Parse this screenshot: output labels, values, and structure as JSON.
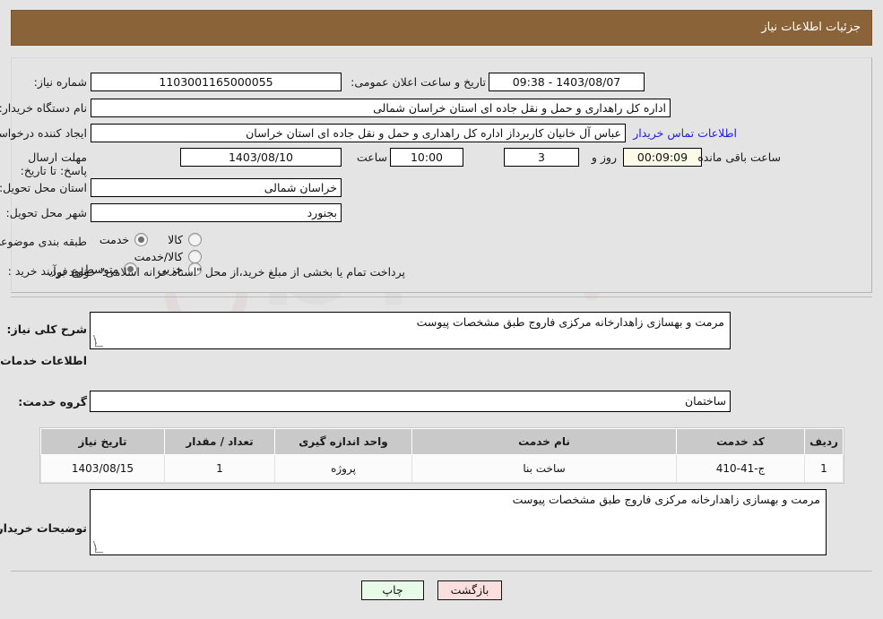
{
  "header": {
    "title": "جزئیات اطلاعات نیاز"
  },
  "form": {
    "need_number_label": "شماره نیاز:",
    "need_number_value": "1103001165000055",
    "announce_label": "تاریخ و ساعت اعلان عمومی:",
    "announce_value": "1403/08/07 - 09:38",
    "buyer_org_label": "نام دستگاه خریدار:",
    "buyer_org_value": "اداره کل راهداری و حمل و نقل جاده ای استان خراسان شمالی",
    "creator_label": "ایجاد کننده درخواست:",
    "creator_value": "عباس آل خانیان کاربرداز اداره کل راهداری و حمل و نقل جاده ای استان خراسان",
    "contact_link": "اطلاعات تماس خریدار",
    "deadline_label": "مهلت ارسال پاسخ: تا تاریخ:",
    "deadline_date": "1403/08/10",
    "hour_label": "ساعت",
    "deadline_time": "10:00",
    "days_value": "3",
    "days_label": "روز و",
    "countdown_value": "00:09:09",
    "remaining_label": "ساعت باقی مانده",
    "province_label": "استان محل تحویل:",
    "province_value": "خراسان شمالی",
    "city_label": "شهر محل تحویل:",
    "city_value": "بجنورد",
    "category_label": "طبقه بندی موضوعی:",
    "category_options": [
      {
        "label": "کالا",
        "selected": false
      },
      {
        "label": "خدمت",
        "selected": true
      },
      {
        "label": "کالا/خدمت",
        "selected": false
      }
    ],
    "process_label": "نوع فرآیند خرید :",
    "process_options": [
      {
        "label": "جزیی",
        "selected": false
      },
      {
        "label": "متوسط",
        "selected": true
      }
    ],
    "payment_note": "پرداخت تمام یا بخشی از مبلغ خرید،از محل \"اسناد خزانه اسلامی\" خواهد بود."
  },
  "summary": {
    "label": "شرح کلی نیاز:",
    "value": "مرمت و بهسازی  زاهدارخانه مرکزی فاروج طبق مشخصات پیوست"
  },
  "services": {
    "section_title": "اطلاعات خدمات مورد نیاز",
    "group_label": "گروه خدمت:",
    "group_value": "ساختمان",
    "columns": [
      "ردیف",
      "کد خدمت",
      "نام خدمت",
      "واحد اندازه گیری",
      "تعداد / مقدار",
      "تاریخ نیاز"
    ],
    "rows": [
      [
        "1",
        "ج-41-410",
        "ساخت بنا",
        "پروژه",
        "1",
        "1403/08/15"
      ]
    ]
  },
  "buyer_notes": {
    "label": "توضیحات خریدار:",
    "value": "مرمت و بهسازی  زاهدارخانه مرکزی فاروج طبق مشخصات پیوست"
  },
  "footer": {
    "print_label": "چاپ",
    "back_label": "بازگشت"
  },
  "watermark": {
    "text": "AriaTender.net"
  },
  "colors": {
    "titlebar": "#8b6338",
    "page_bg": "#e4e4e4",
    "link": "#1f1fdd",
    "timer_bg": "#fbfbe8",
    "print_btn": "#e8fbe8",
    "back_btn": "#fbdede",
    "table_header": "#c9c9c9"
  }
}
